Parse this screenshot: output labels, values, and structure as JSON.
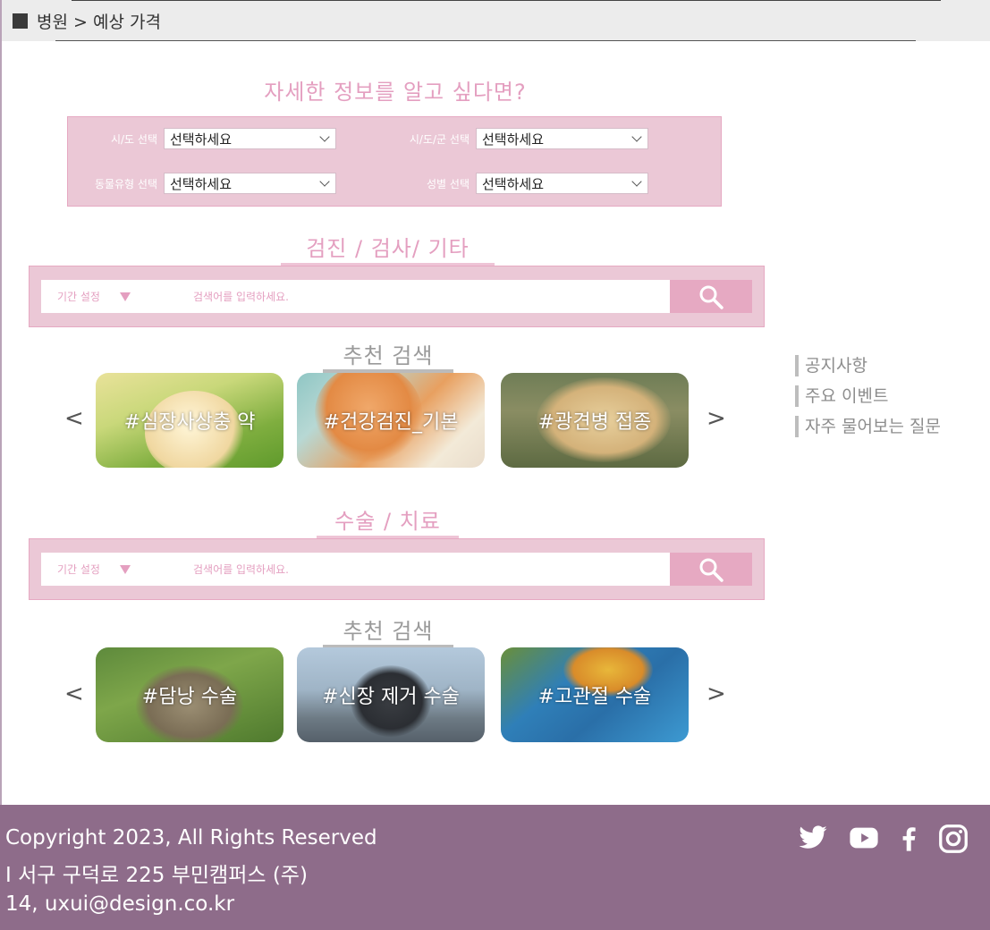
{
  "breadcrumb": {
    "text": "병원 > 예상 가격"
  },
  "headline": "자세한 정보를 알고 싶다면?",
  "filters": [
    {
      "label": "시/도 선택",
      "value": "선택하세요"
    },
    {
      "label": "시/도/군 선택",
      "value": "선택하세요"
    },
    {
      "label": "동물유형 선택",
      "value": "선택하세요"
    },
    {
      "label": "성별 선택",
      "value": "선택하세요"
    }
  ],
  "sections": [
    {
      "title": "검진 / 검사/ 기타",
      "period_label": "기간 설정",
      "search_placeholder": "검색어를 입력하세요.",
      "recommend_title": "추천 검색",
      "cards": [
        "#심장사상충 약",
        "#건강검진_기본",
        "#광견병 접종"
      ]
    },
    {
      "title": "수술 / 치료",
      "period_label": "기간 설정",
      "search_placeholder": "검색어를 입력하세요.",
      "recommend_title": "추천 검색",
      "cards": [
        "#담낭 수술",
        "#신장 제거 수술",
        "#고관절 수술"
      ]
    }
  ],
  "carousel": {
    "prev": "<",
    "next": ">"
  },
  "side_links": [
    "공지사항",
    "주요 이벤트",
    "자주 물어보는 질문"
  ],
  "footer": {
    "line1": "Copyright 2023, All Rights Reserved",
    "line2": "I 서구 구덕로 225 부민캠퍼스 (주)",
    "line3": "14, uxui@design.co.kr",
    "social_icons": [
      "twitter-icon",
      "youtube-icon",
      "facebook-icon",
      "instagram-icon"
    ]
  },
  "colors": {
    "accent": "#e49fc0",
    "panel": "#ebc8d6",
    "footer": "#8e6c8a"
  }
}
